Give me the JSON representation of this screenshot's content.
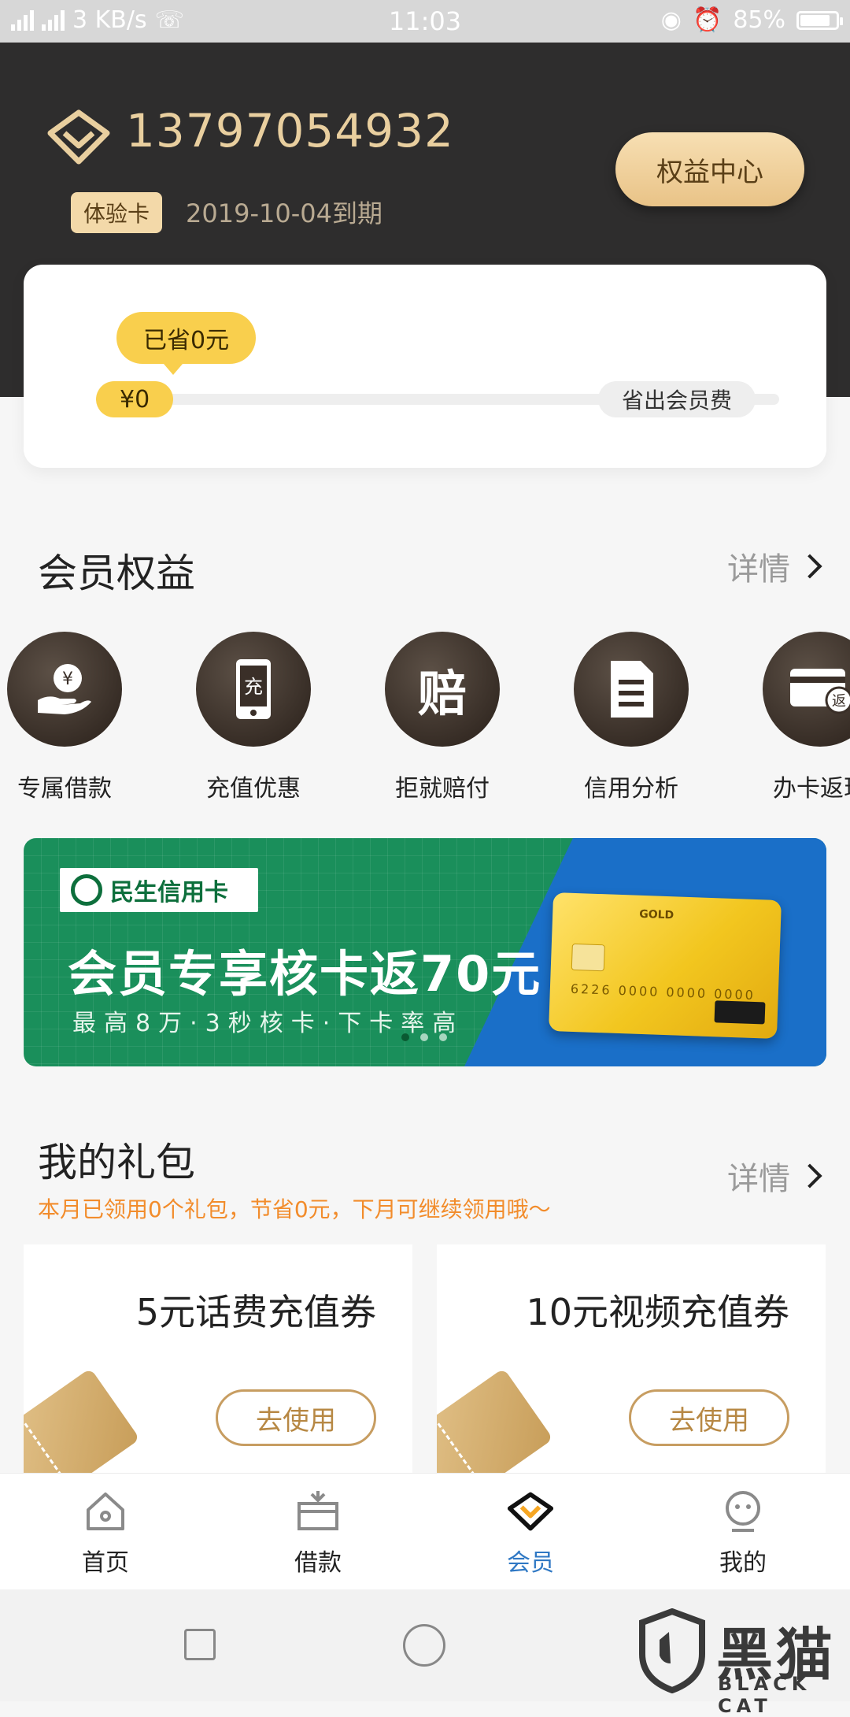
{
  "status_bar": {
    "network": "4G 3G",
    "speed": "3 KB/s",
    "time": "11:03",
    "battery": "85%",
    "battery_level": 0.85
  },
  "member": {
    "phone": "13797054932",
    "card_type": "体验卡",
    "expire": "2019-10-04到期",
    "benefit_center": "权益中心"
  },
  "savings": {
    "saved_label": "已省0元",
    "amount": "¥0",
    "goal_label": "省出会员费",
    "progress": 0
  },
  "benefits_section": {
    "title": "会员权益",
    "more": "详情",
    "items": [
      {
        "label": "专属借款",
        "icon": "yen-hand-icon"
      },
      {
        "label": "充值优惠",
        "icon": "phone-recharge-icon",
        "glyph": "充"
      },
      {
        "label": "拒就赔付",
        "icon": "compensation-icon",
        "glyph": "赔"
      },
      {
        "label": "信用分析",
        "icon": "document-icon"
      },
      {
        "label": "办卡返现",
        "icon": "card-cashback-icon",
        "glyph": "返"
      }
    ]
  },
  "banner": {
    "bank": "民生信用卡",
    "headline": "会员专享核卡返70元",
    "subline": "最高8万·3秒核卡·下卡率高",
    "card_gold": "GOLD",
    "card_number": "6226 0000 0000 0000",
    "slide_count": 3,
    "active_slide": 1,
    "colors": {
      "green": "#1a8f5b",
      "blue": "#1a6fc8"
    }
  },
  "gifts_section": {
    "title": "我的礼包",
    "more": "详情",
    "note": "本月已领用0个礼包，节省0元，下月可继续领用哦～",
    "items": [
      {
        "title": "5元话费充值券",
        "action": "去使用"
      },
      {
        "title": "10元视频充值券",
        "action": "去使用"
      }
    ]
  },
  "bottom_nav": [
    {
      "label": "首页",
      "icon": "home-icon",
      "active": false
    },
    {
      "label": "借款",
      "icon": "loan-icon",
      "active": false
    },
    {
      "label": "会员",
      "icon": "vip-diamond-icon",
      "active": true
    },
    {
      "label": "我的",
      "icon": "profile-icon",
      "active": false
    }
  ],
  "watermark": {
    "cn": "黑猫",
    "en": "BLACK CAT"
  },
  "colors": {
    "accent": "#e9cf9f",
    "hero_bg": "#2e2d2d",
    "yellow": "#f9cf4d",
    "orange_note": "#f28c2b",
    "nav_active": "#2f78c4"
  }
}
